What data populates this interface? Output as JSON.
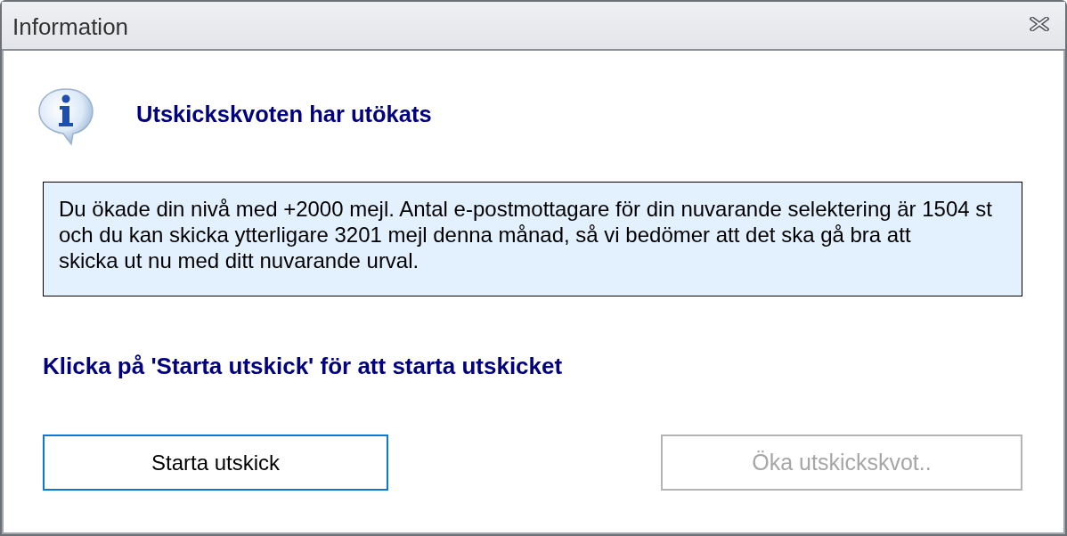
{
  "window": {
    "title": "Information"
  },
  "header": {
    "heading": "Utskickskvoten har utökats"
  },
  "message_lines": [
    "Du ökade din nivå med +2000 mejl. Antal e-postmottagare för din nuvarande selektering är 1504 st",
    "och du kan skicka ytterligare 3201 mejl denna månad, så vi bedömer att det ska gå bra att",
    "skicka ut nu med ditt nuvarande urval."
  ],
  "instruction": "Klicka på 'Starta utskick' för att starta utskicket",
  "buttons": [
    {
      "label": "Starta utskick",
      "focused": true,
      "disabled": false
    },
    {
      "label": "Öka utskickskvot..",
      "focused": false,
      "disabled": true
    }
  ]
}
